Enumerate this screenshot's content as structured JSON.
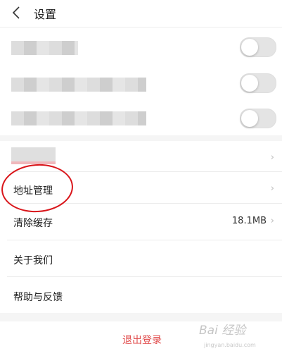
{
  "header": {
    "title": "设置"
  },
  "settings_group": {
    "items": [
      {
        "label_blurred": true,
        "toggle_on": false
      },
      {
        "label_blurred": true,
        "toggle_on": false
      },
      {
        "label_blurred": true,
        "toggle_on": false
      }
    ]
  },
  "menu": {
    "items": [
      {
        "label": "",
        "label_blurred": true,
        "value": ""
      },
      {
        "label": "地址管理",
        "value": ""
      },
      {
        "label": "清除缓存",
        "value": "18.1MB"
      },
      {
        "label": "关于我们",
        "value": ""
      },
      {
        "label": "帮助与反馈",
        "value": ""
      }
    ]
  },
  "logout": {
    "label": "退出登录"
  },
  "watermark": {
    "text": "Bai 经验",
    "sub": "jingyan.baidu.com"
  },
  "colors": {
    "accent_red": "#d9151a",
    "logout_text": "#e04a4a",
    "background": "#ffffff",
    "divider": "#ececec",
    "section_gap": "#f5f5f5"
  },
  "icons": {
    "back": "chevron-left-icon",
    "row_arrow": "chevron-right-icon"
  }
}
